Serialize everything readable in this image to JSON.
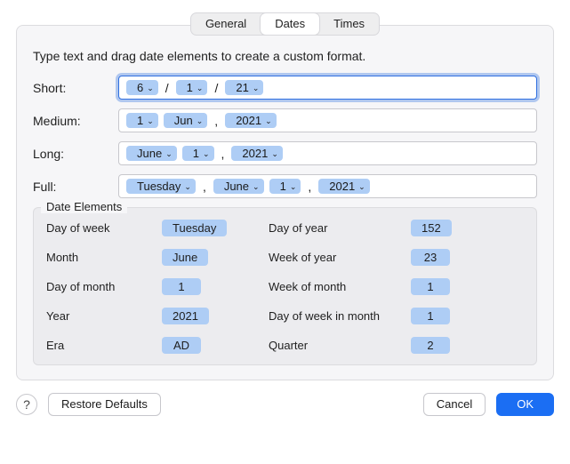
{
  "tabs": {
    "general": "General",
    "dates": "Dates",
    "times": "Times"
  },
  "instruction": "Type text and drag date elements to create a custom format.",
  "formats": {
    "short": {
      "label": "Short:",
      "p1": "6",
      "s1": "/",
      "p2": "1",
      "s2": "/",
      "p3": "21"
    },
    "medium": {
      "label": "Medium:",
      "p1": "1",
      "s1": "",
      "p2": "Jun",
      "s2": ",",
      "p3": "2021"
    },
    "long": {
      "label": "Long:",
      "p1": "June",
      "s1": "",
      "p2": "1",
      "s2": ",",
      "p3": "2021"
    },
    "full": {
      "label": "Full:",
      "p1": "Tuesday",
      "s1": ",",
      "p2": "June",
      "s2": "",
      "p3": "1",
      "s3": ",",
      "p4": "2021"
    }
  },
  "elements": {
    "title": "Date Elements",
    "left": {
      "dow": {
        "label": "Day of week",
        "value": "Tuesday"
      },
      "month": {
        "label": "Month",
        "value": "June"
      },
      "dom": {
        "label": "Day of month",
        "value": "1"
      },
      "year": {
        "label": "Year",
        "value": "2021"
      },
      "era": {
        "label": "Era",
        "value": "AD"
      }
    },
    "right": {
      "doy": {
        "label": "Day of year",
        "value": "152"
      },
      "woy": {
        "label": "Week of year",
        "value": "23"
      },
      "wom": {
        "label": "Week of month",
        "value": "1"
      },
      "dowim": {
        "label": "Day of week in month",
        "value": "1"
      },
      "quarter": {
        "label": "Quarter",
        "value": "2"
      }
    }
  },
  "footer": {
    "help": "?",
    "restore": "Restore Defaults",
    "cancel": "Cancel",
    "ok": "OK"
  }
}
